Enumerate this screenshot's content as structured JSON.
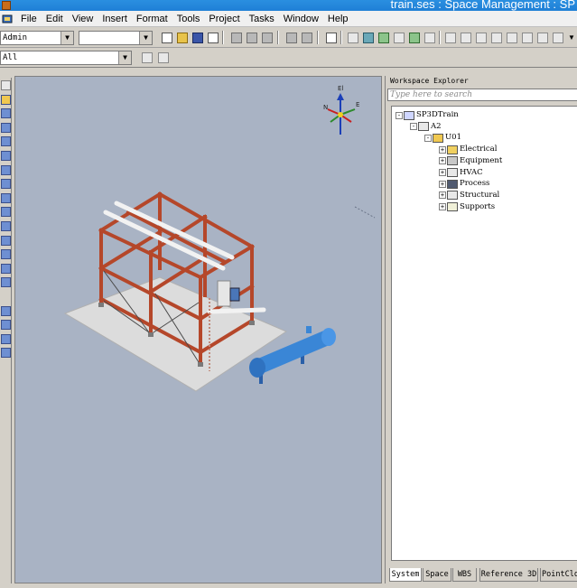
{
  "window": {
    "title": "train.ses : Space Management : SP"
  },
  "menu": [
    "File",
    "Edit",
    "View",
    "Insert",
    "Format",
    "Tools",
    "Project",
    "Tasks",
    "Window",
    "Help"
  ],
  "toolbar": {
    "permission_group_value": "Admin",
    "second_combo_value": "",
    "filter_value": "All"
  },
  "workspace_explorer": {
    "title": "Workspace Explorer",
    "search_placeholder": "Type here to search",
    "tree": [
      {
        "label": "SP3DTrain",
        "icon": "plant-icon",
        "expander": "-"
      },
      {
        "label": "A2",
        "icon": "area-icon",
        "expander": "-"
      },
      {
        "label": "U01",
        "icon": "unit-icon",
        "expander": "-"
      },
      {
        "label": "Electrical",
        "icon": "electrical-folder-icon",
        "expander": "+"
      },
      {
        "label": "Equipment",
        "icon": "equipment-folder-icon",
        "expander": "+"
      },
      {
        "label": "HVAC",
        "icon": "hvac-folder-icon",
        "expander": "+"
      },
      {
        "label": "Process",
        "icon": "process-folder-icon",
        "expander": "+"
      },
      {
        "label": "Structural",
        "icon": "structural-folder-icon",
        "expander": "+"
      },
      {
        "label": "Supports",
        "icon": "supports-folder-icon",
        "expander": "+"
      }
    ],
    "tabs": [
      "System",
      "Space",
      "WBS",
      "Reference 3D",
      "PointClo"
    ]
  },
  "compass": {
    "el": "El",
    "n": "N",
    "e": "E"
  },
  "colors": {
    "titlebar": "#1f7fd6",
    "viewport_bg": "#a9b3c4",
    "steel": "#b5472a",
    "vessel": "#3a86d6"
  }
}
